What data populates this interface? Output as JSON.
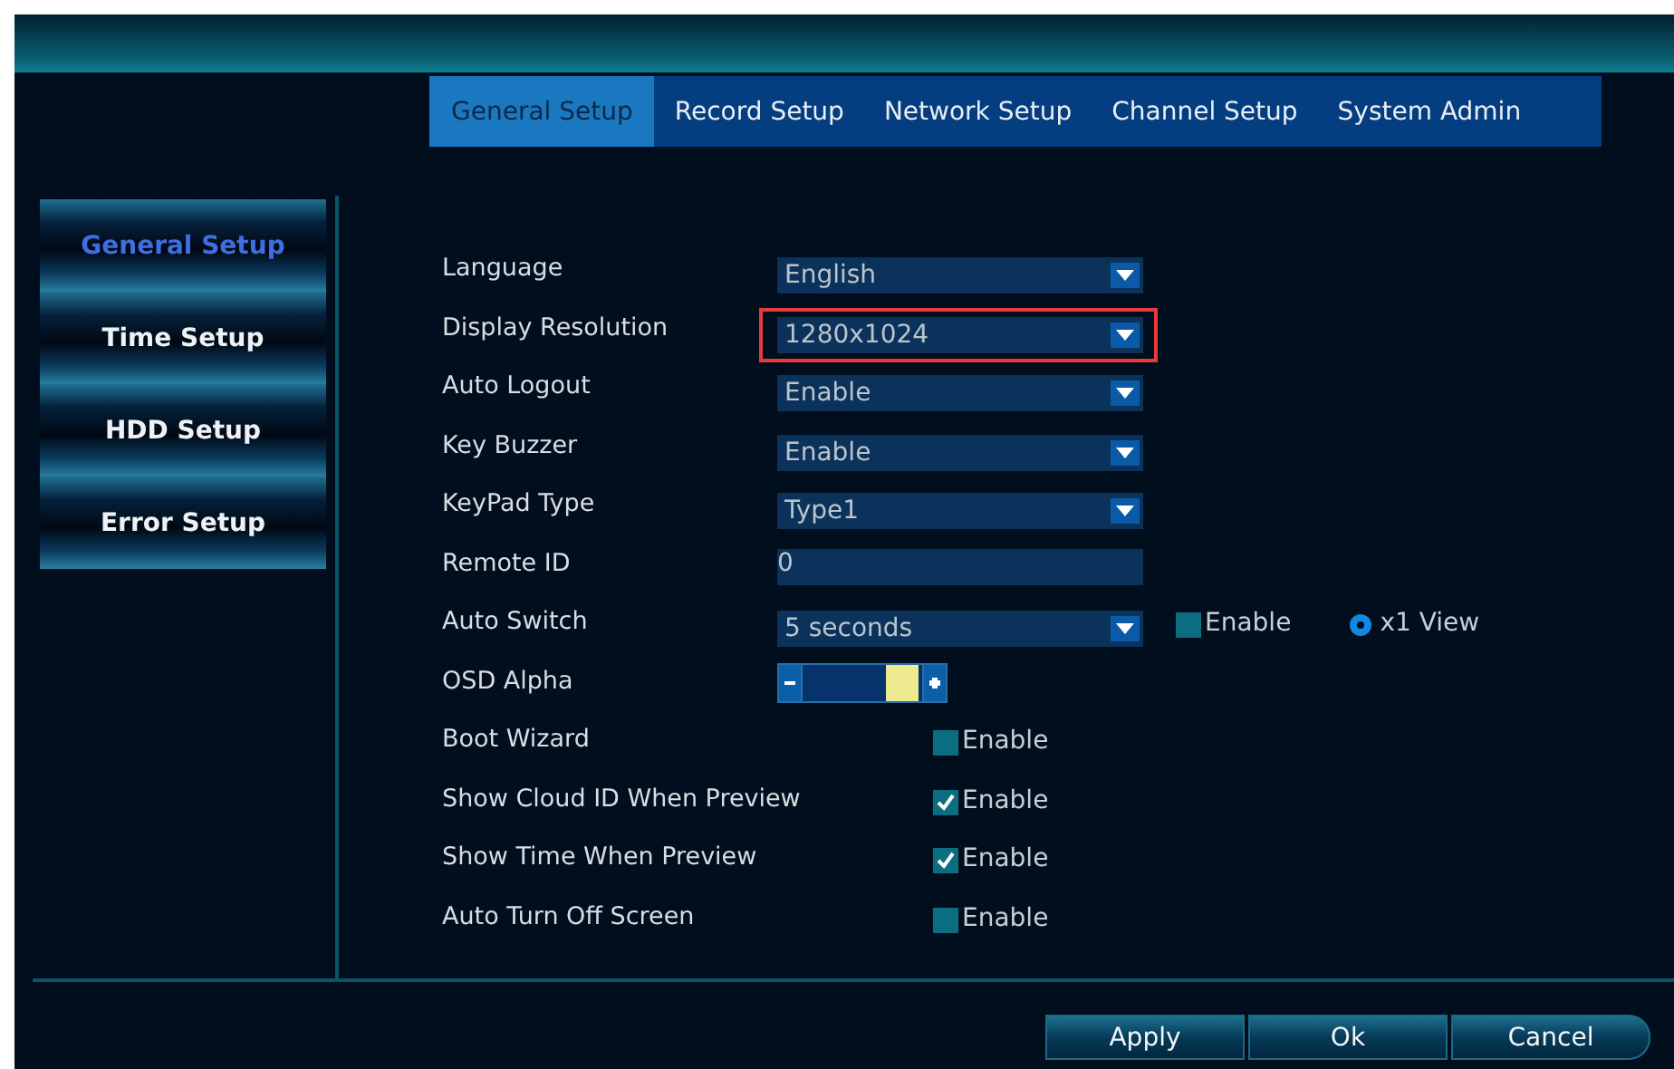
{
  "tabs": [
    {
      "label": "General Setup",
      "selected": true
    },
    {
      "label": "Record Setup",
      "selected": false
    },
    {
      "label": "Network Setup",
      "selected": false
    },
    {
      "label": "Channel Setup",
      "selected": false
    },
    {
      "label": "System Admin",
      "selected": false
    }
  ],
  "sidebar": {
    "items": [
      {
        "label": "General Setup",
        "selected": true
      },
      {
        "label": "Time Setup",
        "selected": false
      },
      {
        "label": "HDD Setup",
        "selected": false
      },
      {
        "label": "Error Setup",
        "selected": false
      }
    ]
  },
  "settings": [
    {
      "label": "Language",
      "kind": "select",
      "value": "English",
      "highlighted": false
    },
    {
      "label": "Display Resolution",
      "kind": "select",
      "value": "1280x1024",
      "highlighted": true
    },
    {
      "label": "Auto Logout",
      "kind": "select",
      "value": "Enable",
      "highlighted": false
    },
    {
      "label": "Key Buzzer",
      "kind": "select",
      "value": "Enable",
      "highlighted": false
    },
    {
      "label": "KeyPad Type",
      "kind": "select",
      "value": "Type1",
      "highlighted": false
    },
    {
      "label": "Remote ID",
      "kind": "input",
      "value": "0"
    },
    {
      "label": "Auto Switch",
      "kind": "select",
      "value": "5 seconds",
      "highlighted": false,
      "extras": [
        {
          "kind": "checkbox",
          "label": "Enable",
          "checked": false
        },
        {
          "kind": "radio",
          "label": "x1 View",
          "selected": true
        }
      ]
    },
    {
      "label": "OSD Alpha",
      "kind": "slider",
      "level": 0.95
    },
    {
      "label": "Boot Wizard",
      "kind": "checkbox",
      "text": "Enable",
      "checked": false
    },
    {
      "label": "Show Cloud ID When Preview",
      "kind": "checkbox",
      "text": "Enable",
      "checked": true
    },
    {
      "label": "Show Time When Preview",
      "kind": "checkbox",
      "text": "Enable",
      "checked": true
    },
    {
      "label": "Auto Turn Off Screen",
      "kind": "checkbox",
      "text": "Enable",
      "checked": false
    }
  ],
  "buttons": [
    "Apply",
    "Ok",
    "Cancel"
  ]
}
